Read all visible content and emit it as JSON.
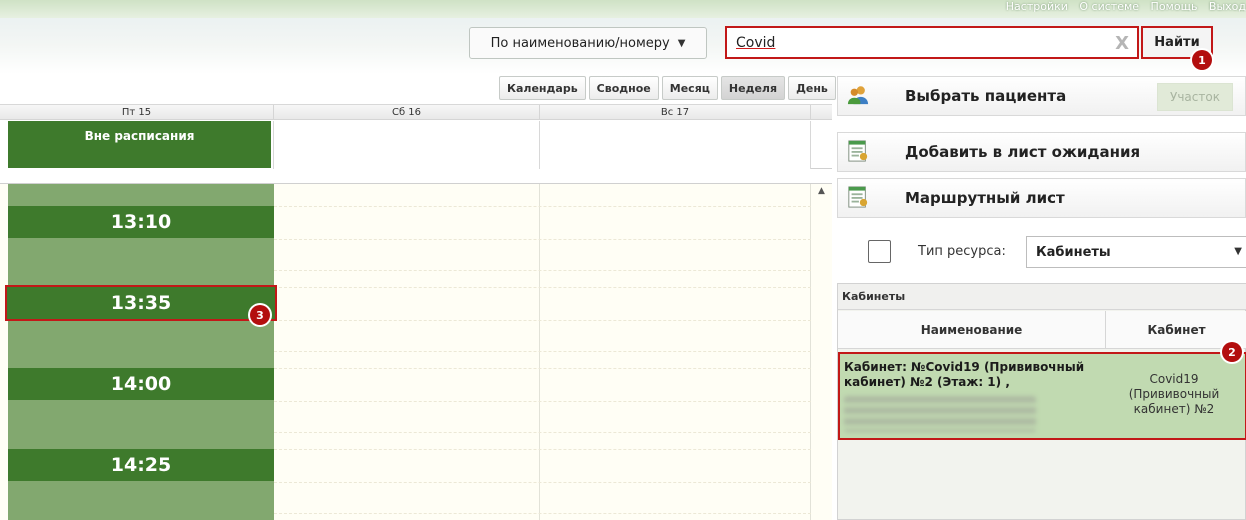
{
  "header": {
    "top_links": [
      "Настройки",
      "О системе",
      "Помощь",
      "Выход"
    ],
    "search_mode": "По наименованию/номеру",
    "search": {
      "value": "Covid",
      "clear_glyph": "X"
    },
    "find_button": "Найти"
  },
  "badges": [
    "1",
    "2",
    "3"
  ],
  "view_switch": [
    "Календарь",
    "Сводное",
    "Месяц",
    "Неделя",
    "День"
  ],
  "calendar": {
    "days": [
      "Пт 15",
      "Сб 16",
      "Вс 17"
    ],
    "outside_schedule": "Вне расписания",
    "slots": [
      "13:10",
      "13:35",
      "14:00",
      "14:25"
    ]
  },
  "right_panel": {
    "select_patient": "Выбрать пациента",
    "plot_button": "Участок",
    "add_waitlist": "Добавить в лист ожидания",
    "route_sheet": "Маршрутный лист",
    "resource_type_label": "Тип ресурса:",
    "resource_type_value": "Кабинеты"
  },
  "rooms": {
    "title": "Кабинеты",
    "columns": [
      "Наименование",
      "Кабинет"
    ],
    "row": {
      "name": "Кабинет: №Covid19 (Прививочный кабинет) №2 (Этаж: 1) ,",
      "code": "Covid19 (Прививочный кабинет) №2"
    }
  },
  "colors": {
    "slot_green": "#3e7a2c",
    "slot_bg": "#82a86f",
    "highlight_red": "#c21818",
    "row_selected": "#c1dab1"
  }
}
